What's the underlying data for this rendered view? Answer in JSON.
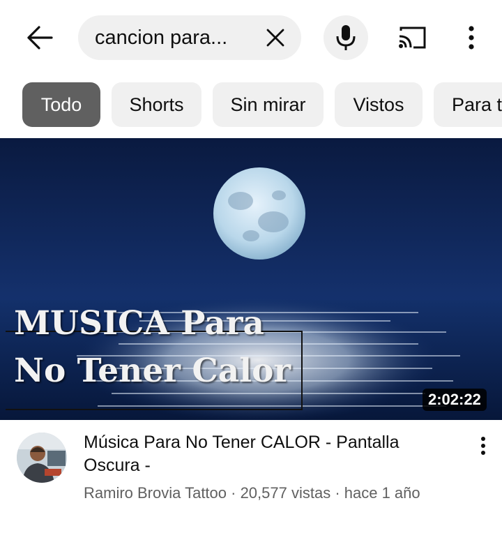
{
  "search": {
    "query": "cancion para..."
  },
  "topbar": {
    "back_icon": "arrow-left-icon",
    "clear_icon": "close-icon",
    "mic_icon": "microphone-icon",
    "cast_icon": "cast-icon",
    "more_icon": "more-vertical-icon"
  },
  "chips": [
    {
      "label": "Todo",
      "active": true
    },
    {
      "label": "Shorts",
      "active": false
    },
    {
      "label": "Sin mirar",
      "active": false
    },
    {
      "label": "Vistos",
      "active": false
    },
    {
      "label": "Para t",
      "active": false
    }
  ],
  "video": {
    "thumbnail_text_line1": "MUSICA Para",
    "thumbnail_text_line2": "No Tener Calor",
    "duration": "2:02:22",
    "title": "Música Para No Tener CALOR - Pantalla Oscura -",
    "channel_stats": "Ramiro Brovia Tattoo · 20,577 vistas · hace 1 año"
  },
  "colors": {
    "chip_active_bg": "#606060",
    "chip_bg": "#f0f0f0",
    "secondary_text": "#606060",
    "night_sky": "#0d1f4a"
  }
}
